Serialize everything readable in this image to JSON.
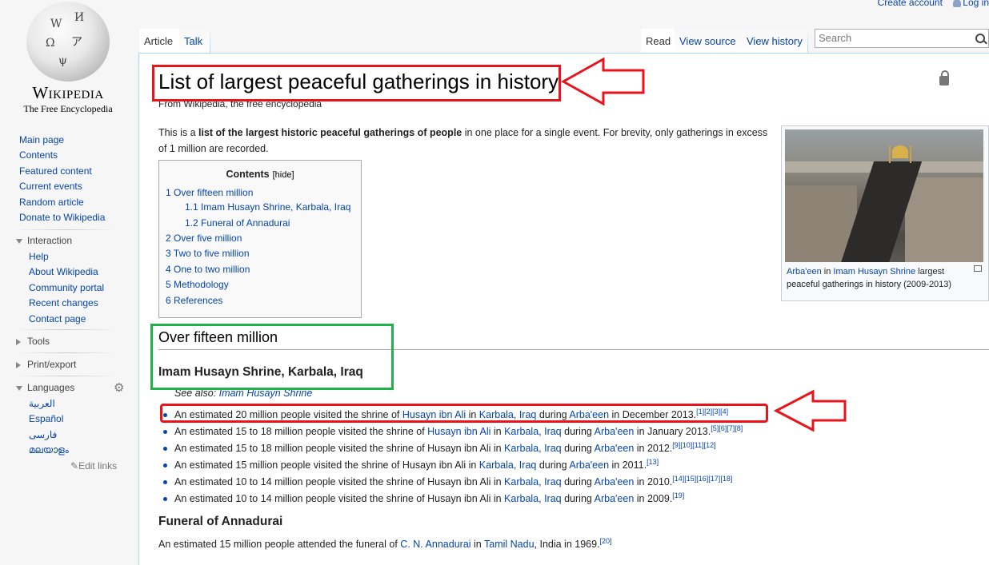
{
  "personal": {
    "create_account": "Create account",
    "login": "Log in"
  },
  "logo": {
    "title": "Wikipedia",
    "subtitle": "The Free Encyclopedia"
  },
  "nav": {
    "main": [
      "Main page",
      "Contents",
      "Featured content",
      "Current events",
      "Random article",
      "Donate to Wikipedia"
    ],
    "interaction_head": "Interaction",
    "interaction": [
      "Help",
      "About Wikipedia",
      "Community portal",
      "Recent changes",
      "Contact page"
    ],
    "tools": "Tools",
    "print": "Print/export",
    "languages_head": "Languages",
    "languages": [
      "العربية",
      "Español",
      "فارسی",
      "മലയാളം"
    ],
    "edit_links": "Edit links"
  },
  "tabs": {
    "article": "Article",
    "talk": "Talk",
    "read": "Read",
    "view_source": "View source",
    "view_history": "View history"
  },
  "search": {
    "placeholder": "Search"
  },
  "page": {
    "title": "List of largest peaceful gatherings in history",
    "tagline": "From Wikipedia, the free encyclopedia",
    "intro_1": "This is a ",
    "intro_bold": "list of the largest historic peaceful gatherings of people",
    "intro_2": " in one place for a single event. For brevity, only gatherings in excess of 1 million are recorded."
  },
  "toc": {
    "title": "Contents",
    "hide": "[hide]",
    "items": [
      "1 Over fifteen million",
      "1.1 Imam Husayn Shrine, Karbala, Iraq",
      "1.2 Funeral of Annadurai",
      "2 Over five million",
      "3 Two to five million",
      "4 One to two million",
      "5 Methodology",
      "6 References"
    ]
  },
  "thumb": {
    "caption_link1": "Arba'een",
    "caption_in": " in ",
    "caption_link2": "Imam Husayn Shrine",
    "caption_rest": " largest peaceful gatherings in history (2009-2013)"
  },
  "section": {
    "h2": "Over fifteen million",
    "h3": "Imam Husayn Shrine, Karbala, Iraq",
    "see_also_label": "See also: ",
    "see_also_link": "Imam Husayn Shrine",
    "items": [
      {
        "pre": "An estimated 20 million people visited the shrine of ",
        "l1": "Husayn ibn Ali",
        "mid": " in ",
        "l2": "Karbala, Iraq",
        "during": " during ",
        "l3": "Arba'een",
        "post": " in December 2013.",
        "refs": "[1][2][3][4]"
      },
      {
        "pre": "An estimated 15 to 18 million people visited the shrine of ",
        "l1": "Husayn ibn Ali",
        "mid": " in ",
        "l2": "Karbala, Iraq",
        "during": " during ",
        "l3": "Arba'een",
        "post": " in January 2013.",
        "refs": "[5][6][7][8]"
      },
      {
        "pre": "An estimated 15 to 18 million people visited the shrine of Husayn ibn Ali in ",
        "l1": "",
        "mid": "",
        "l2": "Karbala, Iraq",
        "during": " during ",
        "l3": "Arba'een",
        "post": " in 2012.",
        "refs": "[9][10][11][12]"
      },
      {
        "pre": "An estimated 15 million people visited the shrine of Husayn ibn Ali in ",
        "l1": "",
        "mid": "",
        "l2": "Karbala, Iraq",
        "during": " during ",
        "l3": "Arba'een",
        "post": " in 2011.",
        "refs": "[13]"
      },
      {
        "pre": "An estimated 10 to 14 million people visited the shrine of Husayn ibn Ali in ",
        "l1": "",
        "mid": "",
        "l2": "Karbala, Iraq",
        "during": " during ",
        "l3": "Arba'een",
        "post": " in 2010.",
        "refs": "[14][15][16][17][18]"
      },
      {
        "pre": "An estimated 10 to 14 million people visited the shrine of Husayn ibn Ali in ",
        "l1": "",
        "mid": "",
        "l2": "Karbala, Iraq",
        "during": " during ",
        "l3": "Arba'een",
        "post": " in 2009.",
        "refs": "[19]"
      }
    ],
    "h3b": "Funeral of Annadurai",
    "last_pre": "An estimated 15 million people attended the funeral of ",
    "last_l1": "C. N. Annadurai",
    "last_mid": " in ",
    "last_l2": "Tamil Nadu",
    "last_post": ", India in 1969.",
    "last_ref": "[20]"
  },
  "colors": {
    "link": "#0645ad",
    "annotation_red": "#e8141c",
    "annotation_green": "#22b04a"
  }
}
